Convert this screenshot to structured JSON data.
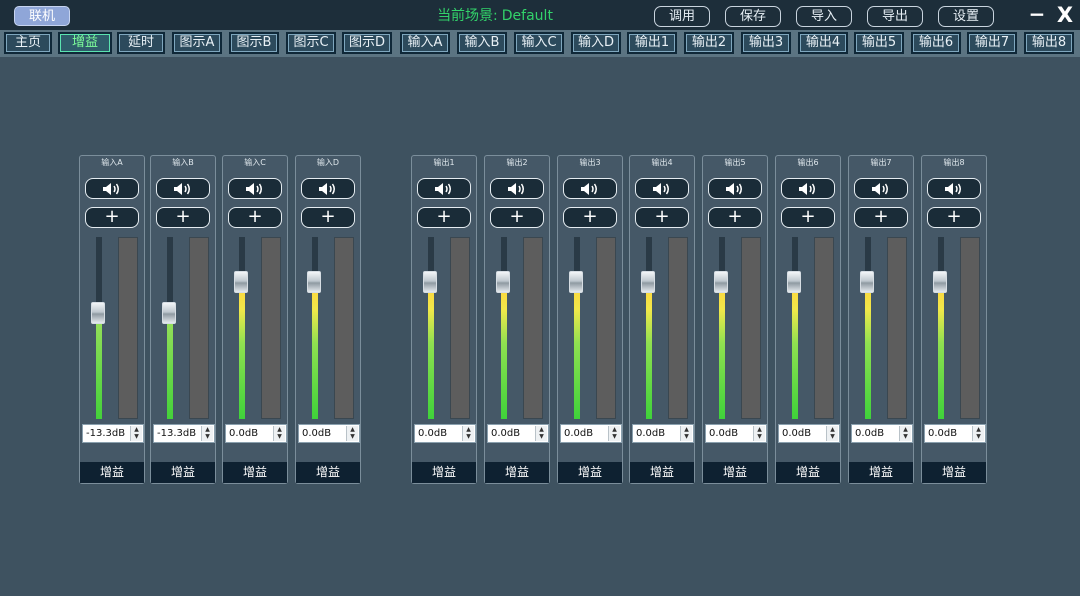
{
  "header": {
    "link_label": "联机",
    "scene_label": "当前场景:",
    "scene_value": "Default",
    "buttons": [
      "调用",
      "保存",
      "导入",
      "导出",
      "设置"
    ],
    "minimize_glyph": "−",
    "close_glyph": "X"
  },
  "tabs": [
    "主页",
    "增益",
    "延时",
    "图示A",
    "图示B",
    "图示C",
    "图示D",
    "输入A",
    "输入B",
    "输入C",
    "输入D",
    "输出1",
    "输出2",
    "输出3",
    "输出4",
    "输出5",
    "输出6",
    "输出7",
    "输出8"
  ],
  "active_tab": "增益",
  "colors": {
    "background": "#3e5260",
    "topbar": "#1d2e3a",
    "scene_text": "#32d26a",
    "level_green": "#3fd23a",
    "level_yellow": "#ffd23a"
  },
  "icons": {
    "mute": "speaker-icon",
    "add": "plus-icon"
  },
  "channels": [
    {
      "title": "输入A",
      "gain": "-13.3dB",
      "level": 0.58,
      "footer": "增益"
    },
    {
      "title": "输入B",
      "gain": "-13.3dB",
      "level": 0.58,
      "footer": "增益"
    },
    {
      "title": "输入C",
      "gain": "0.0dB",
      "level": 0.75,
      "footer": "增益"
    },
    {
      "title": "输入D",
      "gain": "0.0dB",
      "level": 0.75,
      "footer": "增益"
    },
    {
      "title": "输出1",
      "gain": "0.0dB",
      "level": 0.75,
      "footer": "增益"
    },
    {
      "title": "输出2",
      "gain": "0.0dB",
      "level": 0.75,
      "footer": "增益"
    },
    {
      "title": "输出3",
      "gain": "0.0dB",
      "level": 0.75,
      "footer": "增益"
    },
    {
      "title": "输出4",
      "gain": "0.0dB",
      "level": 0.75,
      "footer": "增益"
    },
    {
      "title": "输出5",
      "gain": "0.0dB",
      "level": 0.75,
      "footer": "增益"
    },
    {
      "title": "输出6",
      "gain": "0.0dB",
      "level": 0.75,
      "footer": "增益"
    },
    {
      "title": "输出7",
      "gain": "0.0dB",
      "level": 0.75,
      "footer": "增益"
    },
    {
      "title": "输出8",
      "gain": "0.0dB",
      "level": 0.75,
      "footer": "增益"
    }
  ]
}
